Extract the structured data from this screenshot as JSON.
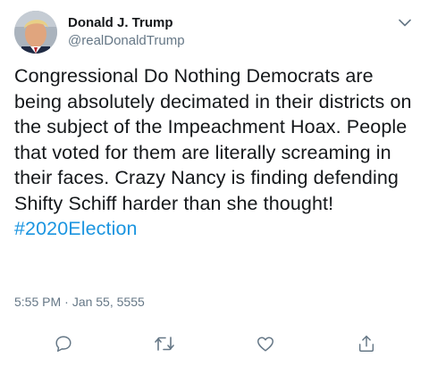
{
  "tweet": {
    "display_name": "Donald J. Trump",
    "handle": "@realDonaldTrump",
    "body": "Congressional Do Nothing Democrats are being absolutely decimated in their districts on the subject of the Impeachment Hoax. People that voted for them are literally screaming in their faces. Crazy Nancy is finding defending Shifty Schiff harder than she thought!",
    "hashtag": "#2020Election",
    "time": "5:55 PM",
    "separator": "·",
    "date": "Jan 55, 5555"
  },
  "icons": {
    "more": "chevron-down-icon",
    "reply": "reply-icon",
    "retweet": "retweet-icon",
    "like": "heart-icon",
    "share": "share-icon"
  },
  "colors": {
    "text": "#14171a",
    "secondary": "#657786",
    "link": "#1b95e0"
  }
}
